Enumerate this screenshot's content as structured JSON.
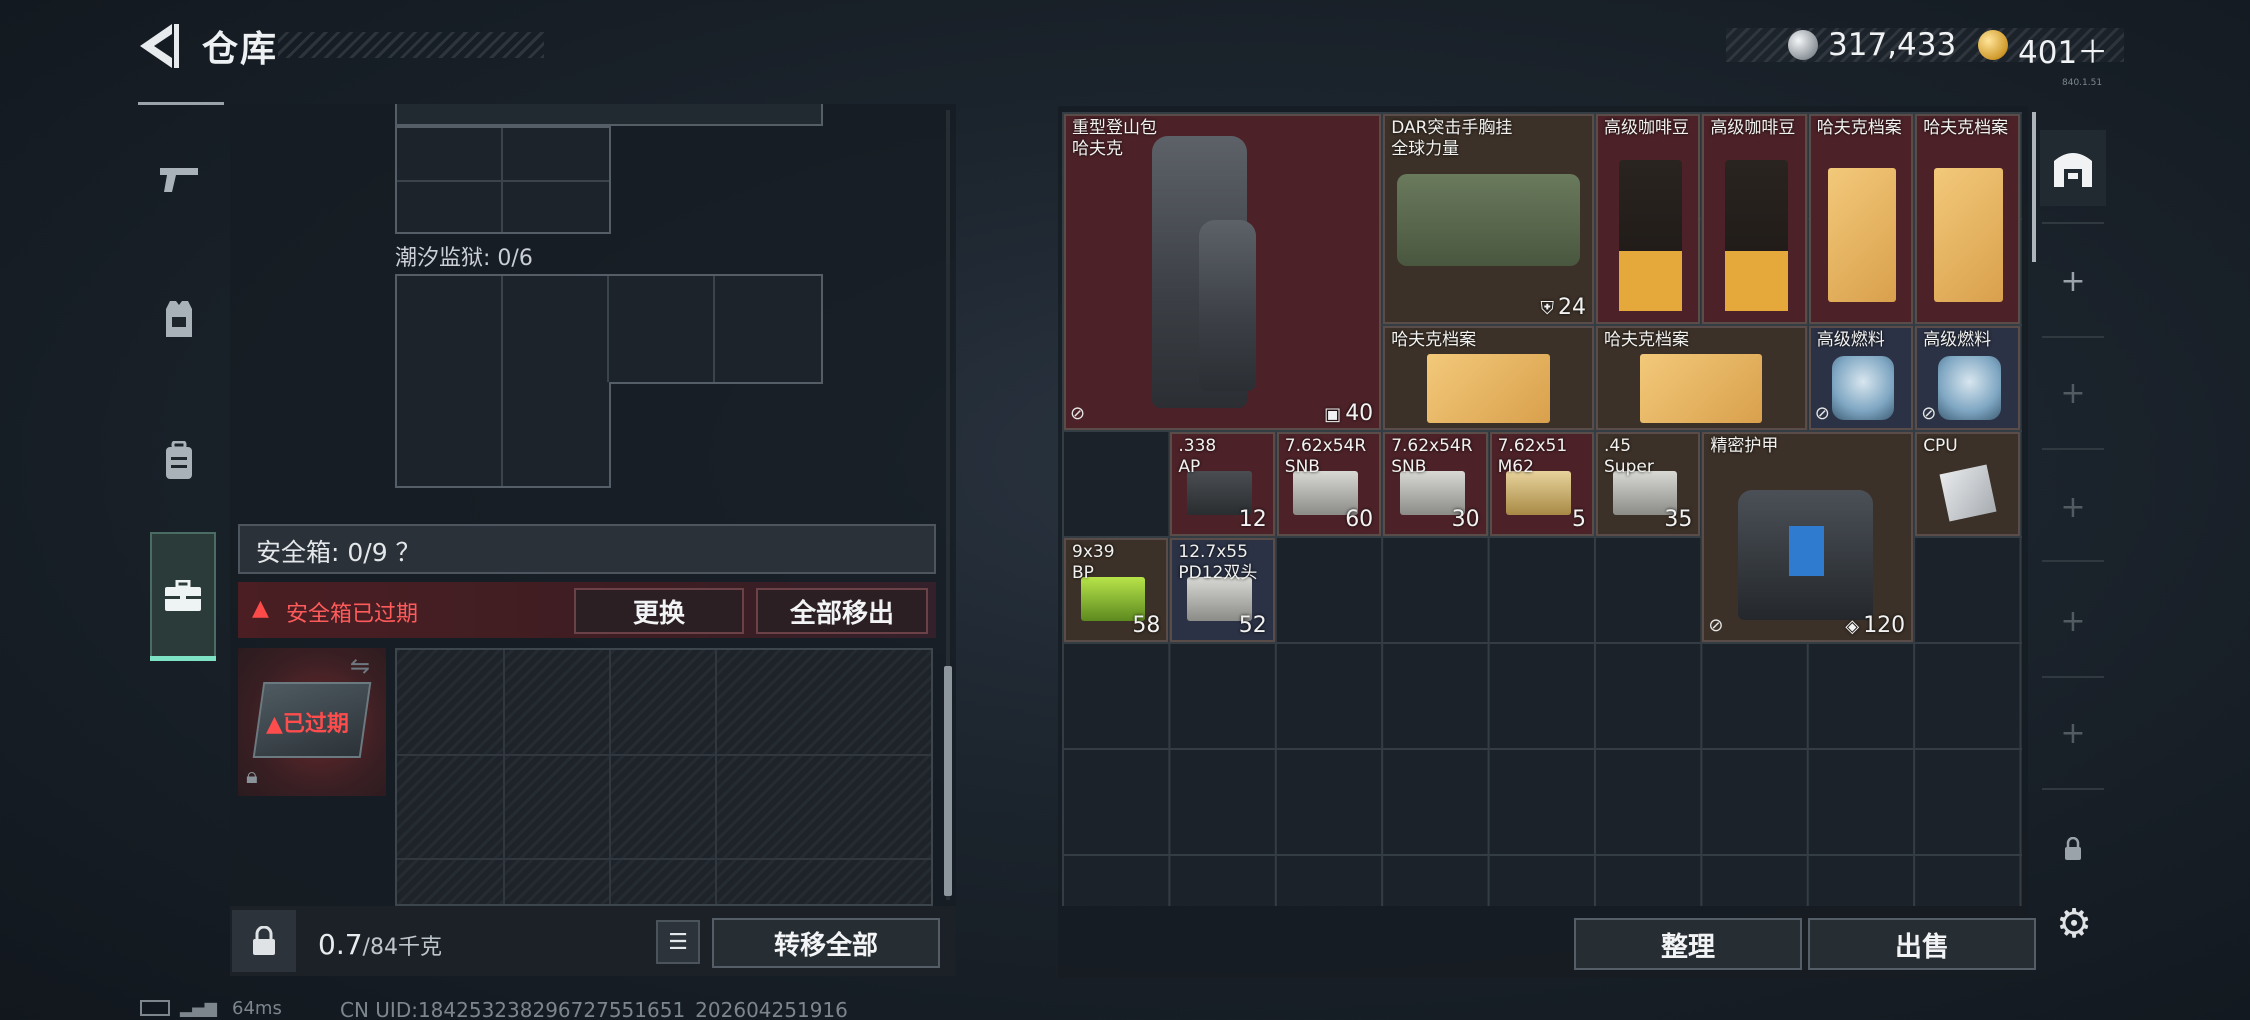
{
  "header": {
    "title": "仓库",
    "silver_amount": "317,433",
    "gold_amount": "401＋",
    "version": "840.1.51"
  },
  "nav": {
    "items": [
      {
        "icon": "pistol-icon"
      },
      {
        "icon": "helmet-icon"
      },
      {
        "icon": "backpack-icon"
      },
      {
        "icon": "briefcase-icon"
      }
    ],
    "active_index": 3
  },
  "left": {
    "prison_label": "潮汐监狱: 0/6",
    "safe_label": "安全箱: 0/9 ？",
    "expired_text": "安全箱已过期",
    "replace_label": "更换",
    "move_all_out_label": "全部移出",
    "case_expired_label": "已过期",
    "weight_value": "0.7",
    "weight_max": "/84千克",
    "transfer_all_label": "转移全部"
  },
  "stash": {
    "items": [
      {
        "name_lines": [
          "重型登山包",
          "哈夫克"
        ],
        "count": "40",
        "count_icon": "backpack-small-icon",
        "color": "red",
        "pic": "backpack",
        "no_trade": true
      },
      {
        "name_lines": [
          "DAR突击手胸挂",
          "全球力量"
        ],
        "count": "24",
        "count_icon": "vest-small-icon",
        "color": "brown",
        "pic": "rig",
        "no_trade": false
      },
      {
        "name_lines": [
          "高级咖啡豆"
        ],
        "count": "",
        "color": "red",
        "pic": "coffee",
        "no_trade": false
      },
      {
        "name_lines": [
          "高级咖啡豆"
        ],
        "count": "",
        "color": "red",
        "pic": "coffee",
        "no_trade": false
      },
      {
        "name_lines": [
          "哈夫克档案"
        ],
        "count": "",
        "color": "red",
        "pic": "folder",
        "no_trade": false
      },
      {
        "name_lines": [
          "哈夫克档案"
        ],
        "count": "",
        "color": "red",
        "pic": "folder",
        "no_trade": false
      },
      {
        "name_lines": [
          "哈夫克档案"
        ],
        "count": "",
        "color": "brown",
        "pic": "folder-wide",
        "no_trade": false
      },
      {
        "name_lines": [
          "哈夫克档案"
        ],
        "count": "",
        "color": "brown",
        "pic": "folder-wide",
        "no_trade": false
      },
      {
        "name_lines": [
          "高级燃料"
        ],
        "count": "",
        "color": "blue",
        "pic": "fuel",
        "no_trade": true
      },
      {
        "name_lines": [
          "高级燃料"
        ],
        "count": "",
        "color": "blue",
        "pic": "fuel",
        "no_trade": true
      },
      {
        "name_lines": [
          ".338",
          "AP"
        ],
        "count": "12",
        "color": "red",
        "pic": "ammo-dark",
        "no_trade": false
      },
      {
        "name_lines": [
          "7.62x54R",
          "SNB"
        ],
        "count": "60",
        "color": "red",
        "pic": "ammo",
        "no_trade": false
      },
      {
        "name_lines": [
          "7.62x54R",
          "SNB"
        ],
        "count": "30",
        "color": "red",
        "pic": "ammo",
        "no_trade": false
      },
      {
        "name_lines": [
          "7.62x51",
          "M62"
        ],
        "count": "5",
        "color": "red",
        "pic": "ammo-gold",
        "no_trade": false
      },
      {
        "name_lines": [
          ".45",
          "Super"
        ],
        "count": "35",
        "color": "brown",
        "pic": "ammo",
        "no_trade": false
      },
      {
        "name_lines": [
          "精密护甲"
        ],
        "count": "120",
        "count_icon": "shield-icon",
        "color": "brown",
        "pic": "armor",
        "no_trade": true
      },
      {
        "name_lines": [
          "CPU"
        ],
        "count": "",
        "color": "brown",
        "pic": "cpu",
        "no_trade": false
      },
      {
        "name_lines": [
          "9x39",
          "BP"
        ],
        "count": "58",
        "color": "brown",
        "pic": "ammo-green",
        "no_trade": false
      },
      {
        "name_lines": [
          "12.7x55",
          "PD12双头"
        ],
        "count": "52",
        "color": "blue",
        "pic": "ammo",
        "no_trade": false
      }
    ]
  },
  "bottom": {
    "sort_label": "整理",
    "sell_label": "出售"
  },
  "status": {
    "ping": "64ms",
    "uid": "CN UID:1842532382967275516​51_202604251916"
  }
}
